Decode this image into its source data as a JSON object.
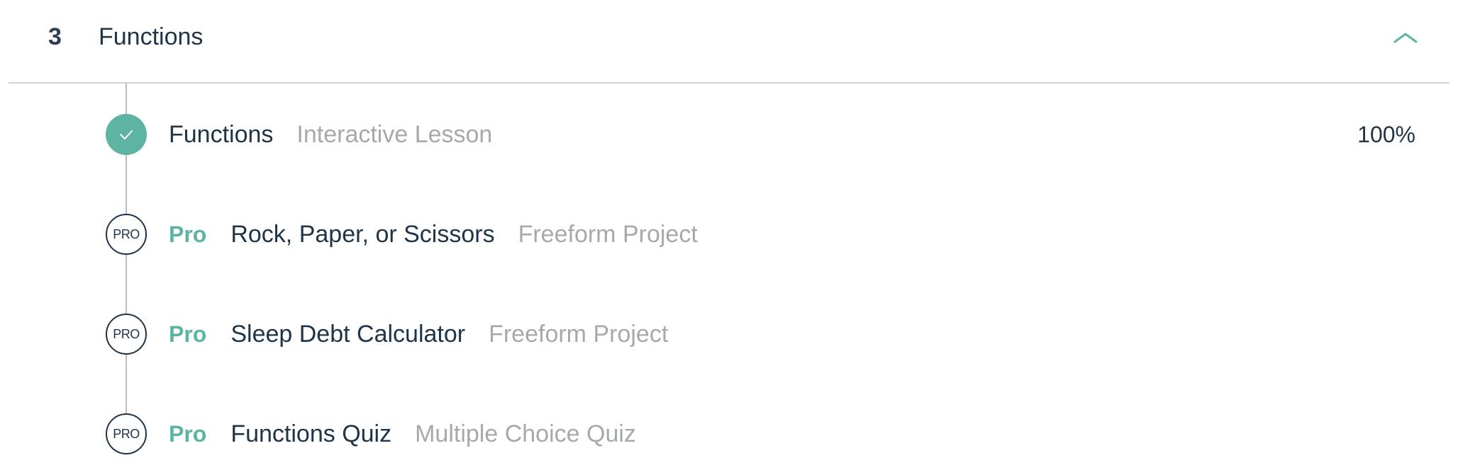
{
  "module": {
    "number": "3",
    "title": "Functions",
    "collapse_icon": "chevron-up-icon",
    "accent_color": "#5db4a2"
  },
  "lessons": [
    {
      "status": "complete",
      "pro_label": "",
      "title": "Functions",
      "type": "Interactive Lesson",
      "progress": "100%"
    },
    {
      "status": "pro",
      "node_label": "PRO",
      "pro_label": "Pro",
      "title": "Rock, Paper, or Scissors",
      "type": "Freeform Project"
    },
    {
      "status": "pro",
      "node_label": "PRO",
      "pro_label": "Pro",
      "title": "Sleep Debt Calculator",
      "type": "Freeform Project"
    },
    {
      "status": "pro",
      "node_label": "PRO",
      "pro_label": "Pro",
      "title": "Functions Quiz",
      "type": "Multiple Choice Quiz"
    }
  ]
}
